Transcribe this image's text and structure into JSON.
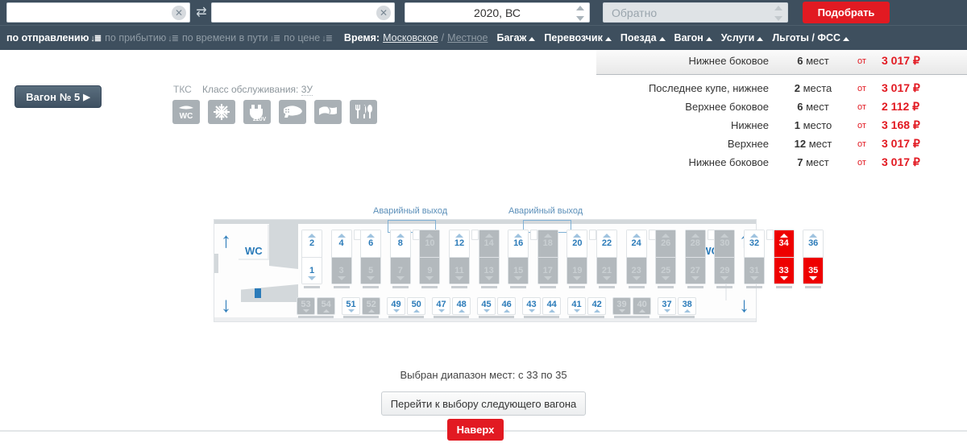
{
  "search": {
    "from_value": "",
    "from_placeholder": "",
    "to_value": "",
    "to_placeholder": "",
    "swap_icon": "swap-icon",
    "clear_icon": "clear-icon",
    "date_value": "2020, ВС",
    "return_placeholder": "Обратно",
    "submit_label": "Подобрать",
    "submit_color": "#e21a22"
  },
  "filters": {
    "sorts": [
      {
        "label": "по отправлению",
        "active": true
      },
      {
        "label": "по прибытию",
        "active": false
      },
      {
        "label": "по времени в пути",
        "active": false
      },
      {
        "label": "по цене",
        "active": false
      }
    ],
    "time_label": "Время:",
    "time_moscow": "Московское",
    "time_sep": "/",
    "time_local": "Местное",
    "menus": [
      "Багаж",
      "Перевозчик",
      "Поезда",
      "Вагон",
      "Услуги",
      "Льготы / ФСС"
    ]
  },
  "prices": {
    "from_word": "от",
    "currency": "₽",
    "rows": [
      {
        "name": "Нижнее боковое",
        "count_num": "6",
        "count_word": "мест",
        "price": "3 017"
      },
      {
        "name": "Последнее купе, нижнее",
        "count_num": "2",
        "count_word": "места",
        "price": "3 017"
      },
      {
        "name": "Верхнее боковое",
        "count_num": "6",
        "count_word": "мест",
        "price": "2 112"
      },
      {
        "name": "Нижнее",
        "count_num": "1",
        "count_word": "место",
        "price": "3 168"
      },
      {
        "name": "Верхнее",
        "count_num": "12",
        "count_word": "мест",
        "price": "3 017"
      },
      {
        "name": "Нижнее боковое",
        "count_num": "7",
        "count_word": "мест",
        "price": "3 017"
      }
    ]
  },
  "wagon": {
    "tab_label": "Вагон",
    "tab_number": "№ 5",
    "carrier": "ТКС",
    "service_class_label": "Класс обслуживания:",
    "service_class_value": "3У",
    "amenities": [
      {
        "icon": "wc-icon",
        "glyph": "WC"
      },
      {
        "icon": "air-conditioning-icon",
        "glyph": "❄"
      },
      {
        "icon": "power-socket-220v-icon",
        "glyph": "220V"
      },
      {
        "icon": "hairdryer-icon",
        "glyph": "hairdryer"
      },
      {
        "icon": "bed-linen-icon",
        "glyph": "linen"
      },
      {
        "icon": "restaurant-icon",
        "glyph": "Ψ"
      }
    ]
  },
  "map": {
    "wc_label": "WC",
    "exit_label": "Аварийный выход",
    "arrow_up_icon": "arrow-up-icon",
    "arrow_down_icon": "arrow-down-icon",
    "compartments": [
      {
        "upper": "2",
        "upper_state": "free",
        "lower": "1",
        "lower_state": "free"
      },
      {
        "upper": "4",
        "upper_state": "free",
        "lower": "3",
        "lower_state": "busy"
      },
      {
        "upper": "6",
        "upper_state": "free",
        "lower": "5",
        "lower_state": "busy"
      },
      {
        "upper": "8",
        "upper_state": "free",
        "lower": "7",
        "lower_state": "busy"
      },
      {
        "upper": "10",
        "upper_state": "busy",
        "lower": "9",
        "lower_state": "busy"
      },
      {
        "upper": "12",
        "upper_state": "free",
        "lower": "11",
        "lower_state": "busy"
      },
      {
        "upper": "14",
        "upper_state": "busy",
        "lower": "13",
        "lower_state": "busy"
      },
      {
        "upper": "16",
        "upper_state": "free",
        "lower": "15",
        "lower_state": "busy"
      },
      {
        "upper": "18",
        "upper_state": "busy",
        "lower": "17",
        "lower_state": "busy"
      },
      {
        "upper": "20",
        "upper_state": "free",
        "lower": "19",
        "lower_state": "busy"
      },
      {
        "upper": "22",
        "upper_state": "free",
        "lower": "21",
        "lower_state": "busy"
      },
      {
        "upper": "24",
        "upper_state": "free",
        "lower": "23",
        "lower_state": "busy"
      },
      {
        "upper": "26",
        "upper_state": "busy",
        "lower": "25",
        "lower_state": "busy"
      },
      {
        "upper": "28",
        "upper_state": "busy",
        "lower": "27",
        "lower_state": "busy"
      },
      {
        "upper": "30",
        "upper_state": "busy",
        "lower": "29",
        "lower_state": "busy"
      },
      {
        "upper": "32",
        "upper_state": "free",
        "lower": "31",
        "lower_state": "busy"
      },
      {
        "upper": "34",
        "upper_state": "sel",
        "lower": "33",
        "lower_state": "sel"
      },
      {
        "upper": "36",
        "upper_state": "free",
        "lower": "35",
        "lower_state": "sel"
      }
    ],
    "side_seats": [
      {
        "num": "53",
        "state": "busy"
      },
      {
        "num": "54",
        "state": "busy"
      },
      {
        "num": "51",
        "state": "free"
      },
      {
        "num": "52",
        "state": "busy"
      },
      {
        "num": "49",
        "state": "free"
      },
      {
        "num": "50",
        "state": "free"
      },
      {
        "num": "47",
        "state": "free"
      },
      {
        "num": "48",
        "state": "free"
      },
      {
        "num": "45",
        "state": "free"
      },
      {
        "num": "46",
        "state": "free"
      },
      {
        "num": "43",
        "state": "free"
      },
      {
        "num": "44",
        "state": "free"
      },
      {
        "num": "41",
        "state": "free"
      },
      {
        "num": "42",
        "state": "free"
      },
      {
        "num": "39",
        "state": "busy"
      },
      {
        "num": "40",
        "state": "busy"
      },
      {
        "num": "37",
        "state": "free"
      },
      {
        "num": "38",
        "state": "free"
      }
    ]
  },
  "footer": {
    "range_text": "Выбран диапазон мест: с 33 по 35",
    "next_wagon_label": "Перейти к выбору следующего вагона",
    "to_top_label": "Наверх"
  },
  "colors": {
    "accent_red": "#e21a22",
    "selected_seat": "#ee0000",
    "header_blue": "#3e4f5e",
    "seat_blue": "#2b7bb9"
  }
}
